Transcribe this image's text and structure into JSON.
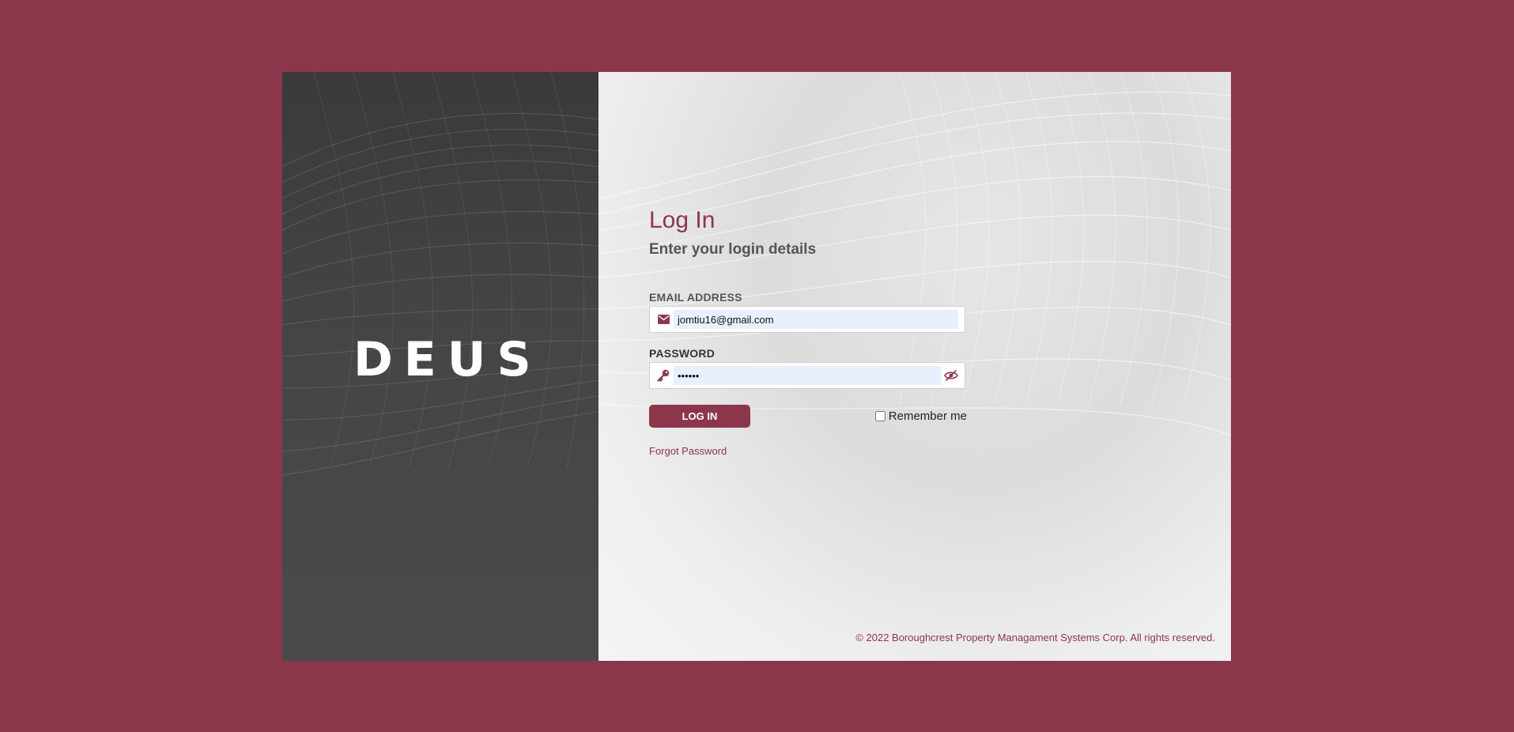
{
  "brand": {
    "logo_text": "DEUS"
  },
  "login": {
    "title": "Log In",
    "subtitle": "Enter your login details",
    "email": {
      "label": "EMAIL ADDRESS",
      "value": "jomtiu16@gmail.com",
      "icon": "envelope-icon"
    },
    "password": {
      "label": "PASSWORD",
      "value": "••••••",
      "icon": "key-icon",
      "toggle_icon": "eye-slash-icon"
    },
    "submit_label": "LOG IN",
    "remember_label": "Remember me",
    "remember_checked": false,
    "forgot_label": "Forgot Password"
  },
  "footer": {
    "copyright": "© 2022 Boroughcrest Property Managament Systems Corp. All rights reserved."
  },
  "colors": {
    "accent": "#8c364c",
    "background": "#8c364c",
    "brand_panel": "#444444",
    "input_fill": "#e8f0fe"
  }
}
